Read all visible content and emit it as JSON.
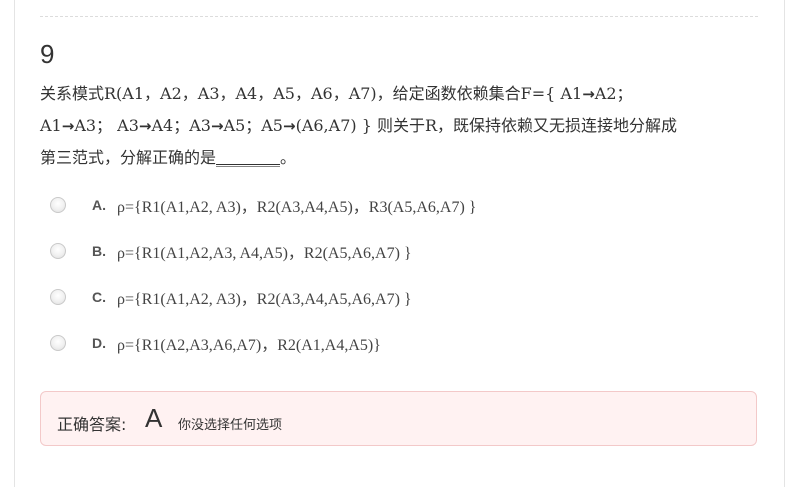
{
  "question": {
    "number": "9",
    "stem": {
      "line1_a": "关系模式R(A1，A2，A3，A4，A5，A6，A7)，给定函数依赖集合F={ A1",
      "line1_b": "A2；",
      "line2_a": "A1",
      "line2_b": "A3； A3",
      "line2_c": "A4；A3",
      "line2_d": "A5；A5",
      "line2_e": "(A6,A7) } 则关于R，既保持依赖又无损连接地分解成",
      "line3_a": "第三范式，分解正确的是",
      "line3_blank": "________",
      "line3_end": "。",
      "arrow": "→"
    },
    "options": [
      {
        "letter": "A.",
        "text": "ρ={R1(A1,A2, A3)，R2(A3,A4,A5)，R3(A5,A6,A7) }"
      },
      {
        "letter": "B.",
        "text": "ρ={R1(A1,A2,A3, A4,A5)，R2(A5,A6,A7) }"
      },
      {
        "letter": "C.",
        "text": "ρ={R1(A1,A2, A3)，R2(A3,A4,A5,A6,A7) }"
      },
      {
        "letter": "D.",
        "text": "ρ={R1(A2,A3,A6,A7)，R2(A1,A4,A5)}"
      }
    ]
  },
  "answer": {
    "label": "正确答案:",
    "value": "A",
    "note": "你没选择任何选项"
  }
}
